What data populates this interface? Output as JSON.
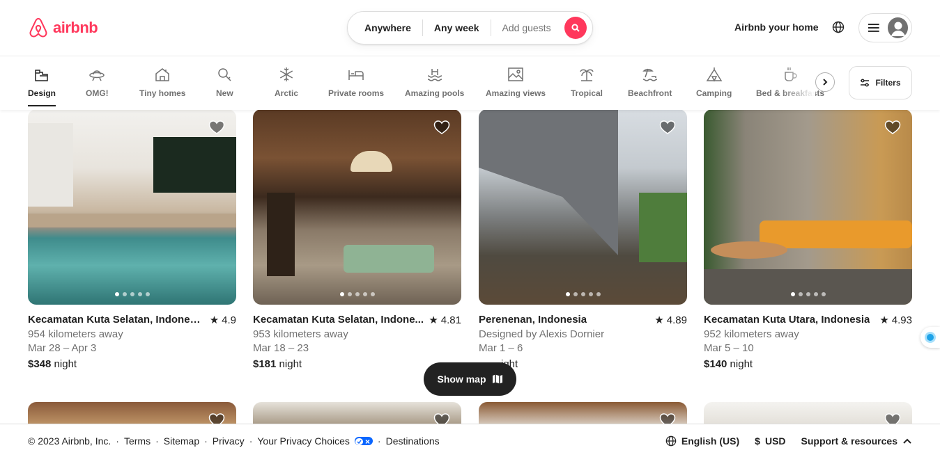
{
  "brand": {
    "name": "airbnb",
    "color": "#ff385c"
  },
  "search": {
    "where": "Anywhere",
    "when": "Any week",
    "guests": "Add guests"
  },
  "header": {
    "host_link": "Airbnb your home"
  },
  "categories": [
    {
      "label": "Design",
      "icon": "design-icon",
      "active": true
    },
    {
      "label": "OMG!",
      "icon": "ufo-icon"
    },
    {
      "label": "Tiny homes",
      "icon": "tiny-home-icon"
    },
    {
      "label": "New",
      "icon": "sparkle-key-icon"
    },
    {
      "label": "Arctic",
      "icon": "snowflake-icon"
    },
    {
      "label": "Private rooms",
      "icon": "bed-icon"
    },
    {
      "label": "Amazing pools",
      "icon": "pool-icon"
    },
    {
      "label": "Amazing views",
      "icon": "view-icon"
    },
    {
      "label": "Tropical",
      "icon": "palm-icon"
    },
    {
      "label": "Beachfront",
      "icon": "beach-icon"
    },
    {
      "label": "Camping",
      "icon": "tent-icon"
    },
    {
      "label": "Bed & breakfasts",
      "icon": "mug-icon"
    }
  ],
  "filters_label": "Filters",
  "listings": [
    {
      "location": "Kecamatan Kuta Selatan, Indonesia",
      "rating": "4.9",
      "line2": "954 kilometers away",
      "dates": "Mar 28 – Apr 3",
      "price": "$348",
      "unit": "night"
    },
    {
      "location": "Kecamatan Kuta Selatan, Indone...",
      "rating": "4.81",
      "line2": "953 kilometers away",
      "dates": "Mar 18 – 23",
      "price": "$181",
      "unit": "night"
    },
    {
      "location": "Perenenan, Indonesia",
      "rating": "4.89",
      "line2": "Designed by Alexis Dornier",
      "dates": "Mar 1 – 6",
      "price": "",
      "unit": "ight"
    },
    {
      "location": "Kecamatan Kuta Utara, Indonesia",
      "rating": "4.93",
      "line2": "952 kilometers away",
      "dates": "Mar 5 – 10",
      "price": "$140",
      "unit": "night"
    }
  ],
  "show_map": "Show map",
  "footer": {
    "copyright": "© 2023 Airbnb, Inc.",
    "links": [
      "Terms",
      "Sitemap",
      "Privacy",
      "Your Privacy Choices",
      "Destinations"
    ],
    "language": "English (US)",
    "currency_symbol": "$",
    "currency": "USD",
    "support": "Support & resources"
  }
}
